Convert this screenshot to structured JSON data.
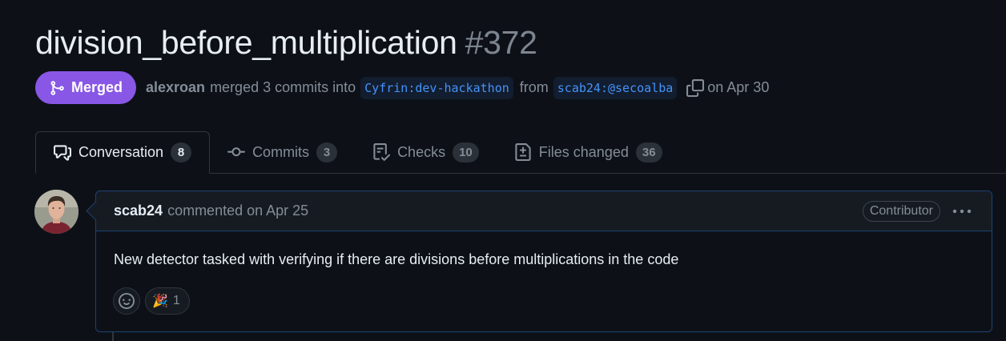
{
  "pr": {
    "title": "division_before_multiplication",
    "number": "#372",
    "state": "Merged",
    "author": "alexroan",
    "merged_text": "merged 3 commits into",
    "base_branch": "Cyfrin:dev-hackathon",
    "from_text": "from",
    "head_branch": "scab24:@secoalba",
    "date_text": "on Apr 30"
  },
  "tabs": [
    {
      "label": "Conversation",
      "count": "8",
      "icon": "comment-discussion-icon"
    },
    {
      "label": "Commits",
      "count": "3",
      "icon": "git-commit-icon"
    },
    {
      "label": "Checks",
      "count": "10",
      "icon": "checklist-icon"
    },
    {
      "label": "Files changed",
      "count": "36",
      "icon": "file-diff-icon"
    }
  ],
  "comment": {
    "author": "scab24",
    "action": "commented on Apr 25",
    "role": "Contributor",
    "body": "New detector tasked with verifying if there are divisions before multiplications in the code",
    "reaction_emoji": "🎉",
    "reaction_count": "1"
  },
  "colors": {
    "background": "#0d1117",
    "merged": "#8957e5",
    "link": "#4493f8",
    "muted": "#848d97"
  }
}
